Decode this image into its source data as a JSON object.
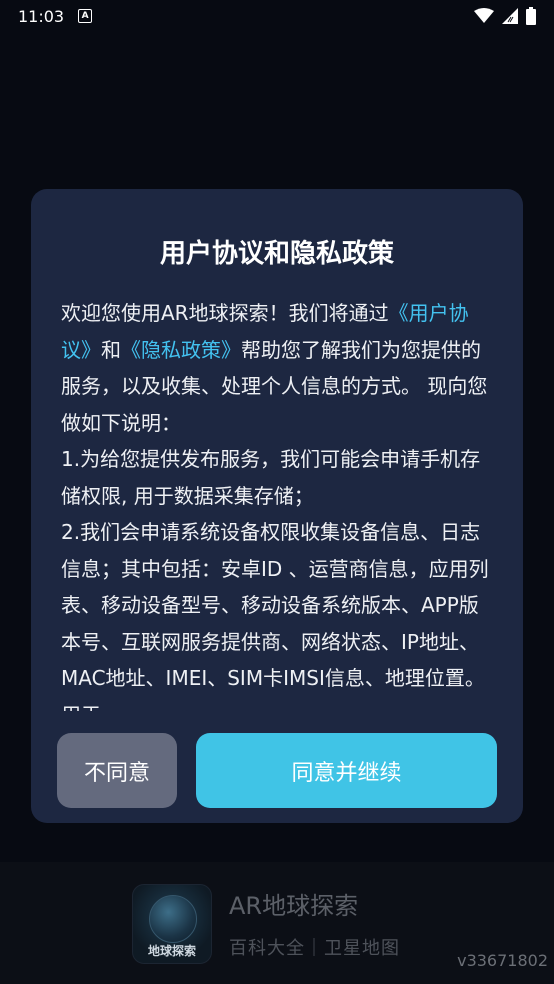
{
  "status_bar": {
    "time": "11:03",
    "a_badge": "A"
  },
  "dialog": {
    "title": "用户协议和隐私政策",
    "body": {
      "p1_prefix": "欢迎您使用AR地球探索！我们将通过",
      "user_agreement_link": "《用户协议》",
      "and": "和",
      "privacy_link": "《隐私政策》",
      "p1_suffix": "帮助您了解我们为您提供的服务，以及收集、处理个人信息的方式。 现向您做如下说明：",
      "item1": "1.为给您提供发布服务，我们可能会申请手机存储权限, 用于数据采集存储；",
      "item2": "2.我们会申请系统设备权限收集设备信息、日志信息；其中包括：安卓ID 、运营商信息，应用列表、移动设备型号、移动设备系统版本、APP版本号、互联网服务提供商、网络状态、IP地址、MAC地址、IMEI、SIM卡IMSI信息、地理位置。用于"
    },
    "decline_label": "不同意",
    "agree_label": "同意并继续"
  },
  "splash": {
    "logo_label": "地球探索",
    "app_name": "AR地球探索",
    "tagline": "百科大全｜卫星地图",
    "version": "v33671802"
  }
}
